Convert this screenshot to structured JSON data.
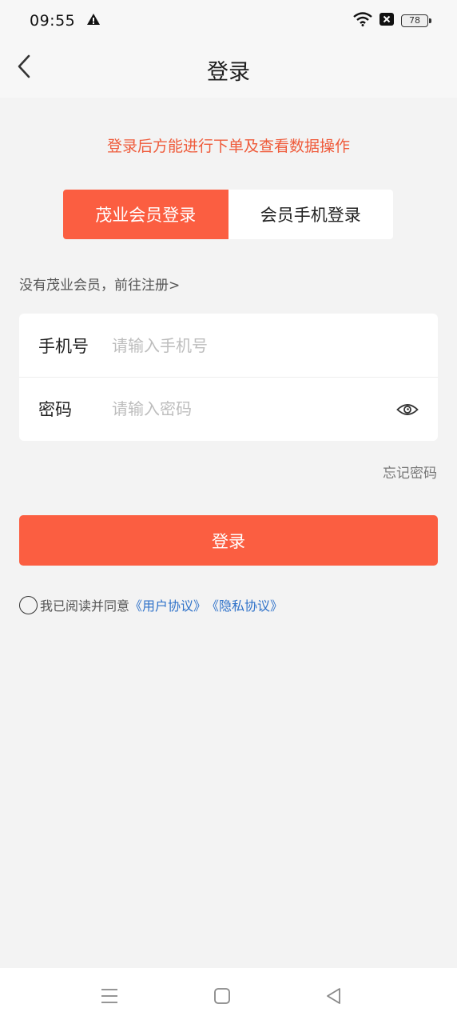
{
  "status_bar": {
    "time": "09:55",
    "battery": "78",
    "icons": [
      "alert-icon",
      "wifi-icon",
      "no-sim-icon",
      "battery-icon"
    ]
  },
  "header": {
    "title": "登录",
    "back_icon": "chevron-left-icon"
  },
  "notice": "登录后方能进行下单及查看数据操作",
  "tabs": [
    {
      "label": "茂业会员登录",
      "active": true
    },
    {
      "label": "会员手机登录",
      "active": false
    }
  ],
  "register_link": "没有茂业会员，前往注册>",
  "form": {
    "phone": {
      "label": "手机号",
      "placeholder": "请输入手机号",
      "value": ""
    },
    "password": {
      "label": "密码",
      "placeholder": "请输入密码",
      "value": "",
      "toggle_icon": "eye-icon"
    }
  },
  "forgot_password": "忘记密码",
  "login_button": "登录",
  "agreement": {
    "prefix": "我已阅读并同意",
    "user_agreement": "《用户协议》",
    "privacy_policy": "《隐私协议》",
    "checked": false
  },
  "colors": {
    "accent": "#fb5e41",
    "notice": "#ef5b3b",
    "link": "#2f72c9",
    "background": "#f3f3f3"
  },
  "system_nav": [
    "menu-icon",
    "home-icon",
    "back-triangle-icon"
  ]
}
